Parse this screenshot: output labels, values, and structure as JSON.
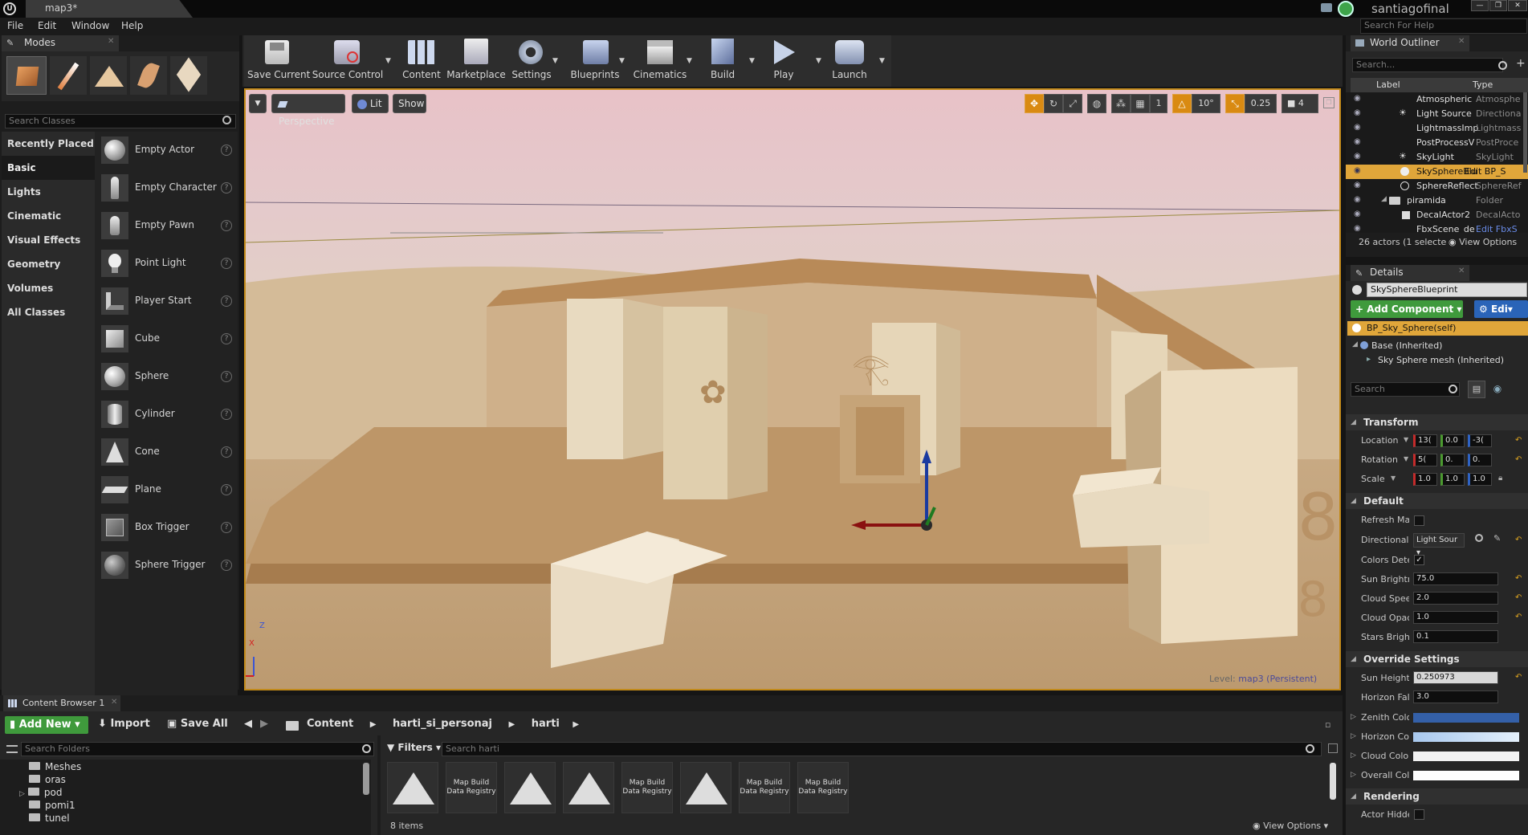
{
  "title_tab": "map3*",
  "user": "santiagofinal",
  "help_search_placeholder": "Search For Help",
  "menu": [
    "File",
    "Edit",
    "Window",
    "Help"
  ],
  "modes": {
    "title": "Modes",
    "search_placeholder": "Search Classes",
    "categories": [
      "Recently Placed",
      "Basic",
      "Lights",
      "Cinematic",
      "Visual Effects",
      "Geometry",
      "Volumes",
      "All Classes"
    ],
    "selected_category": "Basic",
    "items": [
      "Empty Actor",
      "Empty Character",
      "Empty Pawn",
      "Point Light",
      "Player Start",
      "Cube",
      "Sphere",
      "Cylinder",
      "Cone",
      "Plane",
      "Box Trigger",
      "Sphere Trigger"
    ]
  },
  "toolbar": {
    "buttons": [
      "Save Current",
      "Source Control",
      "Content",
      "Marketplace",
      "Settings",
      "Blueprints",
      "Cinematics",
      "Build",
      "Play",
      "Launch"
    ]
  },
  "viewport": {
    "perspective_label": "Perspective",
    "lit_label": "Lit",
    "show_label": "Show",
    "grid_snap": "10°",
    "scale_snap": "0.25",
    "camera_speed": "4",
    "level_prefix": "Level:",
    "level_name": "map3 (Persistent)",
    "axis_labels": {
      "x": "X",
      "z": "Z"
    }
  },
  "outliner": {
    "title": "World Outliner",
    "search_placeholder": "Search...",
    "col_label": "Label",
    "col_type": "Type",
    "rows": [
      {
        "label": "Atmospheric",
        "type": "Atmosphe"
      },
      {
        "label": "Light Source",
        "type": "Directiona"
      },
      {
        "label": "LightmassImp",
        "type": "Lightmass"
      },
      {
        "label": "PostProcessV",
        "type": "PostProce"
      },
      {
        "label": "SkyLight",
        "type": "SkyLight"
      },
      {
        "label": "SkySphereBlu",
        "type": "Edit BP_S"
      },
      {
        "label": "SphereReflect",
        "type": "SphereRef"
      },
      {
        "label": "piramida",
        "type": "Folder"
      },
      {
        "label": "DecalActor2",
        "type": "DecalActo"
      },
      {
        "label": "FbxScene_de",
        "type": "Edit FbxS"
      }
    ],
    "selected_index": 5,
    "status": "26 actors (1 selecte",
    "view_options": "View Options"
  },
  "details": {
    "title": "Details",
    "object_name": "SkySphereBlueprint",
    "add_component": "Add Component",
    "edit_label": "Edi",
    "self_label": "BP_Sky_Sphere(self)",
    "base_label": "Base (Inherited)",
    "mesh_label": "Sky Sphere mesh (Inherited)",
    "search_placeholder": "Search",
    "transform": {
      "section": "Transform",
      "location_label": "Location",
      "location": [
        "13(",
        "0.0",
        "-3("
      ],
      "rotation_label": "Rotation",
      "rotation": [
        "5(",
        "0.",
        "0."
      ],
      "scale_label": "Scale",
      "scale": [
        "1.0",
        "1.0",
        "1.0"
      ]
    },
    "default_section": "Default",
    "default_props": [
      {
        "label": "Refresh Ma",
        "kind": "checkbox",
        "checked": false
      },
      {
        "label": "Directional I",
        "kind": "dropdown",
        "value": "Light Sour"
      },
      {
        "label": "Colors Dete",
        "kind": "checkbox",
        "checked": true
      },
      {
        "label": "Sun Brightn",
        "kind": "number",
        "value": "75.0"
      },
      {
        "label": "Cloud Speec",
        "kind": "number",
        "value": "2.0"
      },
      {
        "label": "Cloud Opaci",
        "kind": "number",
        "value": "1.0"
      },
      {
        "label": "Stars Bright",
        "kind": "number",
        "value": "0.1"
      }
    ],
    "override_section": "Override Settings",
    "override_props": [
      {
        "label": "Sun Height",
        "value": "0.250973"
      },
      {
        "label": "Horizon Fall",
        "value": "3.0"
      }
    ],
    "color_props": [
      {
        "label": "Zenith Color",
        "color": "#3460a8"
      },
      {
        "label": "Horizon Col",
        "color": "#c8dcf2"
      },
      {
        "label": "Cloud Color",
        "color": "#f2f2f2"
      },
      {
        "label": "Overall Colc",
        "color": "#ffffff"
      }
    ],
    "rendering_section": "Rendering",
    "actor_hidden": "Actor Hidde"
  },
  "content_browser": {
    "title": "Content Browser 1",
    "add_new": "Add New",
    "import": "Import",
    "save_all": "Save All",
    "path": [
      "Content",
      "harti_si_personaj",
      "harti"
    ],
    "folder_search": "Search Folders",
    "filters": "Filters",
    "asset_search": "Search harti",
    "folders": [
      "Meshes",
      "oras",
      "pod",
      "pomi1",
      "tunel"
    ],
    "assets": [
      {
        "kind": "map",
        "label": ""
      },
      {
        "kind": "registry",
        "label": "Map Build Data Registry"
      },
      {
        "kind": "map",
        "label": ""
      },
      {
        "kind": "map",
        "label": ""
      },
      {
        "kind": "registry",
        "label": "Map Build Data Registry"
      },
      {
        "kind": "map",
        "label": ""
      },
      {
        "kind": "registry",
        "label": "Map Build Data Registry"
      },
      {
        "kind": "registry",
        "label": "Map Build Data Registry"
      }
    ],
    "item_count": "8 items",
    "view_options": "View Options"
  }
}
